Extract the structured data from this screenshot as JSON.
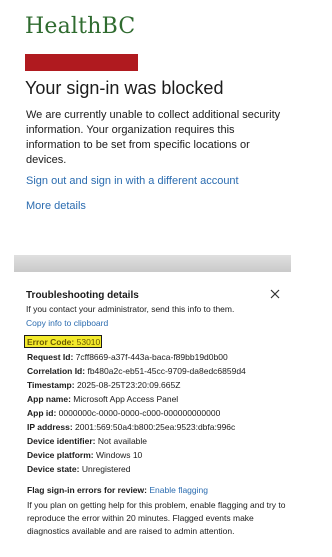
{
  "brand": {
    "logo_text": "HealthBC"
  },
  "header": {
    "title": "Your sign-in was blocked"
  },
  "message": "We are currently unable to collect additional security information. Your organization requires this information to be set from specific locations or devices.",
  "links": {
    "sign_out": "Sign out and sign in with a different account",
    "more_details": "More details"
  },
  "troubleshooting": {
    "title": "Troubleshooting details",
    "subtitle": "If you contact your administrator, send this info to them.",
    "copy_link": "Copy info to clipboard",
    "error_label": "Error Code:",
    "error_code": "53010",
    "rows": [
      {
        "key": "Request Id:",
        "value": "7cff8669-a37f-443a-baca-f89bb19d0b00"
      },
      {
        "key": "Correlation Id:",
        "value": "fb480a2c-eb51-45cc-9709-da8edc6859d4"
      },
      {
        "key": "Timestamp:",
        "value": "2025-08-25T23:20:09.665Z"
      },
      {
        "key": "App name:",
        "value": "Microsoft App Access Panel"
      },
      {
        "key": "App id:",
        "value": "0000000c-0000-0000-c000-000000000000"
      },
      {
        "key": "IP address:",
        "value": "2001:569:50a4:b800:25ea:9523:dbfa:996c"
      },
      {
        "key": "Device identifier:",
        "value": "Not available"
      },
      {
        "key": "Device platform:",
        "value": "Windows 10"
      },
      {
        "key": "Device state:",
        "value": "Unregistered"
      }
    ],
    "flag_label": "Flag sign-in errors for review:",
    "flag_link": "Enable flagging",
    "flag_description": "If you plan on getting help for this problem, enable flagging and try to reproduce the error within 20 minutes. Flagged events make diagnostics available and are raised to admin attention."
  },
  "colors": {
    "brand_green": "#2f6b2f",
    "link_blue": "#2b6cb0",
    "redaction_red": "#b01a1f",
    "highlight_yellow": "#f3ea2b"
  },
  "icons": {
    "close": "close-icon"
  }
}
